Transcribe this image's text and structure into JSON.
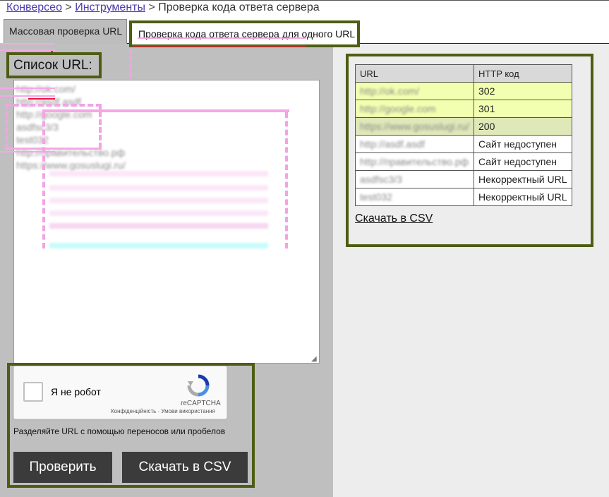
{
  "breadcrumb": {
    "items": [
      "Конверсео",
      "Инструменты"
    ],
    "separator": ">",
    "current": "Проверка кода ответа сервера"
  },
  "tabs": [
    {
      "label": "Массовая проверка URL",
      "active": true
    },
    {
      "label": "Проверка кода ответа сервера для одного URL",
      "active": false
    }
  ],
  "url_list": {
    "label": "Список URL:",
    "lines": [
      "http://ok.com/",
      "http://asdf.asdf",
      "http://google.com",
      "asdfsc3/3",
      "test032",
      "http://правительство.рф",
      "https://www.gosuslugi.ru/"
    ]
  },
  "captcha": {
    "label": "Я не робот",
    "brand": "reCAPTCHA",
    "links": "Конфіденційність · Умови використання"
  },
  "hint": "Разделяйте URL с помощью переносов или пробелов",
  "buttons": {
    "check": "Проверить",
    "download_csv": "Скачать в CSV"
  },
  "results": {
    "headers": [
      "URL",
      "HTTP код"
    ],
    "rows": [
      {
        "url": "http://ok.com/",
        "code": "302",
        "bg": "#f3ffb0"
      },
      {
        "url": "http://google.com",
        "code": "301",
        "bg": "#f3ffb0"
      },
      {
        "url": "https://www.gosuslugi.ru/",
        "code": "200",
        "bg": "#dfe8b8"
      },
      {
        "url": "http://asdf.asdf",
        "code": "Сайт недоступен",
        "bg": "#ffffff"
      },
      {
        "url": "http://правительство.рф",
        "code": "Сайт недоступен",
        "bg": "#ffffff"
      },
      {
        "url": "asdfsc3/3",
        "code": "Некорректный URL",
        "bg": "#ffffff"
      },
      {
        "url": "test032",
        "code": "Некорректный URL",
        "bg": "#ffffff"
      }
    ],
    "download_link": "Скачать в CSV"
  },
  "colors": {
    "highlight_border": "#4e5d14",
    "left_pane": "#bfbfbf",
    "right_pane": "#ededed",
    "button": "#3b3b3b",
    "link": "#4b3bb0"
  }
}
